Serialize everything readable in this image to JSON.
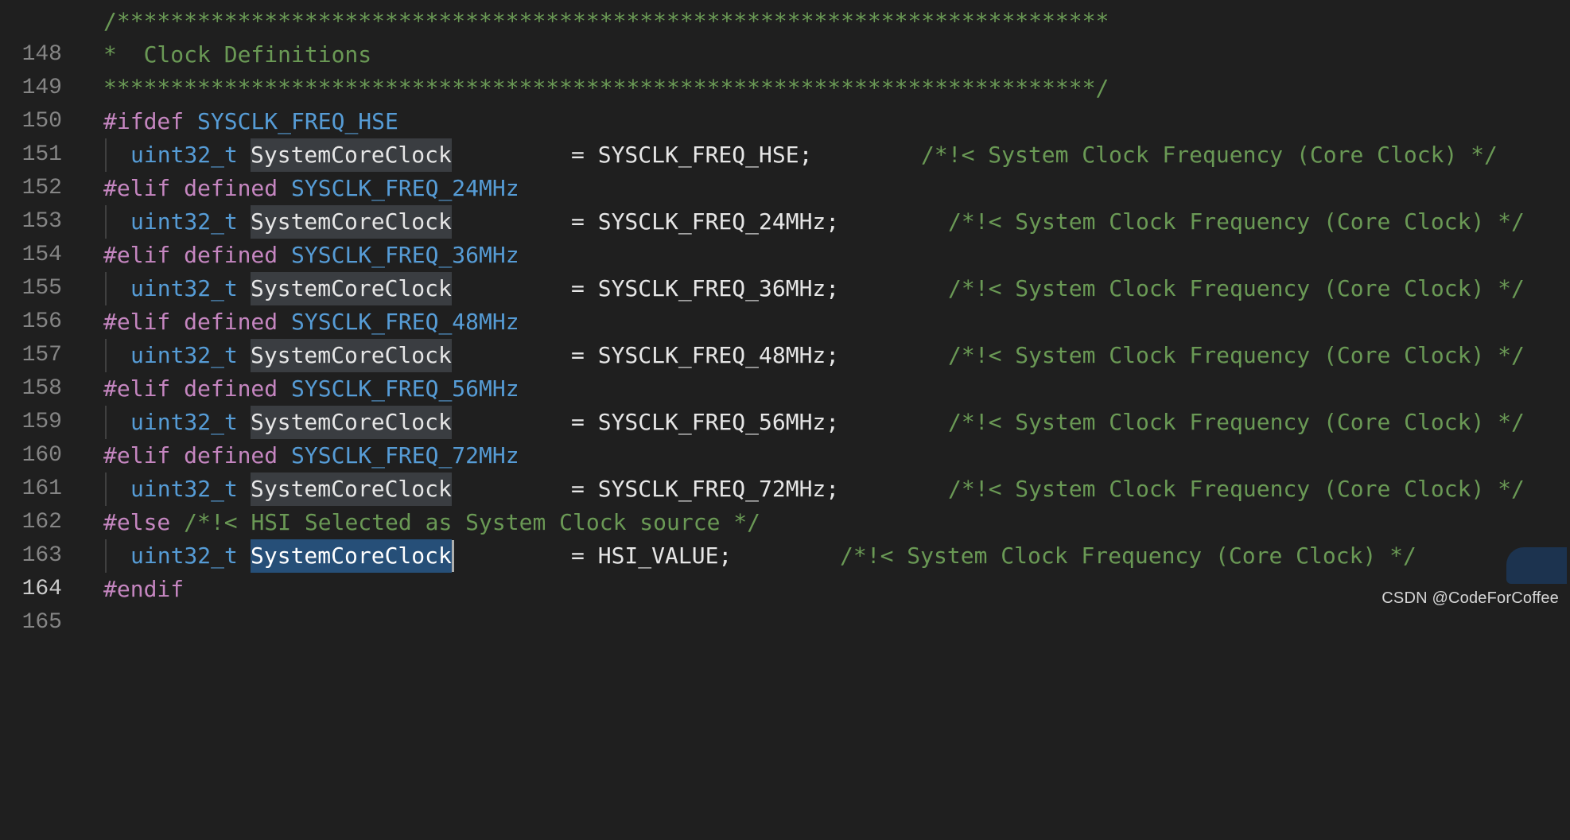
{
  "editor": {
    "theme_colors": {
      "background": "#1f1f1f",
      "comment": "#6a9955",
      "preprocessor": "#c586c0",
      "macro": "#569cd6",
      "type": "#569cd6",
      "identifier": "#e6e6e6",
      "line_number": "#858585",
      "selection": "#264f78",
      "word_highlight": "#3a3d41"
    },
    "active_line": 164,
    "lines": [
      {
        "num": "148",
        "comment": "/**************************************************************************"
      },
      {
        "num": "149",
        "comment": "*  Clock Definitions"
      },
      {
        "num": "150",
        "comment": "**************************************************************************/"
      },
      {
        "num": "151",
        "directive": "#ifdef",
        "macro": "SYSCLK_FREQ_HSE"
      },
      {
        "num": "152",
        "type": "uint32_t",
        "var": "SystemCoreClock",
        "assign": "= SYSCLK_FREQ_HSE;",
        "comment": "/*!< System Clock Frequency (Core Clock) */"
      },
      {
        "num": "153",
        "directive": "#elif defined",
        "macro": "SYSCLK_FREQ_24MHz"
      },
      {
        "num": "154",
        "type": "uint32_t",
        "var": "SystemCoreClock",
        "assign": "= SYSCLK_FREQ_24MHz;",
        "comment": "/*!< System Clock Frequency (Core Clock) */"
      },
      {
        "num": "155",
        "directive": "#elif defined",
        "macro": "SYSCLK_FREQ_36MHz"
      },
      {
        "num": "156",
        "type": "uint32_t",
        "var": "SystemCoreClock",
        "assign": "= SYSCLK_FREQ_36MHz;",
        "comment": "/*!< System Clock Frequency (Core Clock) */"
      },
      {
        "num": "157",
        "directive": "#elif defined",
        "macro": "SYSCLK_FREQ_48MHz"
      },
      {
        "num": "158",
        "type": "uint32_t",
        "var": "SystemCoreClock",
        "assign": "= SYSCLK_FREQ_48MHz;",
        "comment": "/*!< System Clock Frequency (Core Clock) */"
      },
      {
        "num": "159",
        "directive": "#elif defined",
        "macro": "SYSCLK_FREQ_56MHz"
      },
      {
        "num": "160",
        "type": "uint32_t",
        "var": "SystemCoreClock",
        "assign": "= SYSCLK_FREQ_56MHz;",
        "comment": "/*!< System Clock Frequency (Core Clock) */"
      },
      {
        "num": "161",
        "directive": "#elif defined",
        "macro": "SYSCLK_FREQ_72MHz"
      },
      {
        "num": "162",
        "type": "uint32_t",
        "var": "SystemCoreClock",
        "assign": "= SYSCLK_FREQ_72MHz;",
        "comment": "/*!< System Clock Frequency (Core Clock) */"
      },
      {
        "num": "163",
        "directive": "#else",
        "comment": "/*!< HSI Selected as System Clock source */"
      },
      {
        "num": "164",
        "type": "uint32_t",
        "var": "SystemCoreClock",
        "assign": "= HSI_VALUE;",
        "comment": "/*!< System Clock Frequency (Core Clock) */"
      },
      {
        "num": "165",
        "directive": "#endif"
      }
    ]
  },
  "watermark": "CSDN @CodeForCoffee"
}
